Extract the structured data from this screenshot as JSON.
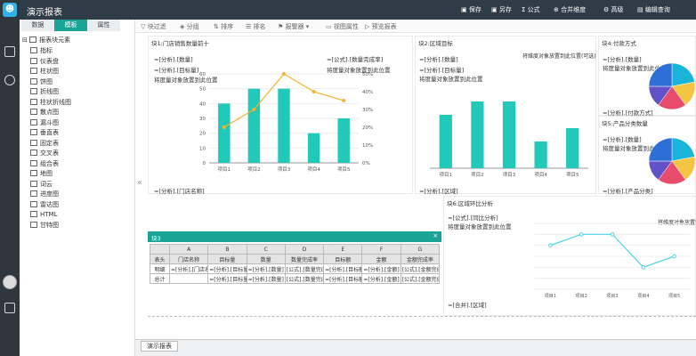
{
  "app": {
    "title": "演示报表"
  },
  "toolbar_top": {
    "save": "保存",
    "saveas": "另存",
    "formula": "公式",
    "merge": "合并维度",
    "advanced": "高级",
    "edit_query": "编辑查询"
  },
  "panel": {
    "tabs": [
      "数据",
      "模板",
      "属性"
    ],
    "root": "报表块元素",
    "items": [
      "指标",
      "仪表盘",
      "柱状图",
      "饼图",
      "折线图",
      "柱状折线图",
      "散点图",
      "漏斗图",
      "垂直表",
      "固定表",
      "交叉表",
      "组合表",
      "地图",
      "词云",
      "进度图",
      "雷达图",
      "HTML",
      "甘特图"
    ]
  },
  "toolbar": {
    "filter": "块过滤",
    "group": "分组",
    "sort": "排序",
    "rank": "排名",
    "alert": "报警器",
    "view_attr": "视图属性",
    "preview": "预览报表"
  },
  "blocks": {
    "b1": {
      "title": "块1:门店销售数量前十",
      "l1": "=[分析].[数量]",
      "l2": "=[公式].[数量完成率]",
      "l3": "=[分析].[目标量]",
      "l4": "将度量对象放置到此位置",
      "l5": "将度量对象放置到此位置",
      "bottom": "=[分析].[门店名称]"
    },
    "b2": {
      "title": "块2:区域目标",
      "l1": "=[分析].[数量]",
      "l2": "将维度对象放置到此位置(可选)",
      "l3": "=[分析].[目标量]",
      "l4": "将度量对象放置到此位置",
      "bottom": "=[分析].[区域]"
    },
    "b4": {
      "title": "块4:付款方式",
      "l1": "=[分析].[数量]",
      "l2": "将度量对象放置到此位置",
      "bottom": "=[分析].[付款方式]"
    },
    "b5": {
      "title": "块5:产品分类数量",
      "l1": "=[分析].[数量]",
      "l2": "将度量对象放置到此位置",
      "bottom": "=[分析].[产品分类]"
    },
    "b3": {
      "title": "块3"
    },
    "b6": {
      "title": "块6:区域环比分析",
      "l1": "=[公式].[同比分析]",
      "l2": "将维度对象放置到此位置",
      "l3": "将度量对象放置到此位置",
      "bottom": "=[合并].[区域]"
    }
  },
  "table": {
    "cols": [
      "A",
      "B",
      "C",
      "D",
      "E",
      "F",
      "G"
    ],
    "header": [
      "表头",
      "门店名称",
      "目标量",
      "数量",
      "数量完成率",
      "目标额",
      "金额",
      "金额完成率"
    ],
    "detail": [
      "明细",
      "=[分析].[门店名称]",
      "=[分析].[目标量]",
      "=[分析].[数量]",
      "[公式].[数量完成率]",
      "=[分析].[目标额]",
      "=[分析].[金额]",
      "[公式].[金额完成率]"
    ],
    "total": [
      "总计",
      "",
      "=[分析].[目标量]",
      "=[分析].[数量]",
      "[公式].[数量完成率]",
      "=[分析].[目标额]",
      "=[分析].[金额]",
      "[公式].[金额完成率]"
    ]
  },
  "sheet_tab": "演示报表",
  "chart_data": [
    {
      "type": "bar",
      "categories": [
        "项目1",
        "项目2",
        "项目3",
        "项目4",
        "项目5"
      ],
      "series": [
        {
          "values": [
            40,
            50,
            50,
            20,
            30
          ]
        }
      ],
      "line": [
        20,
        30,
        50,
        40,
        35
      ],
      "ylim": [
        0,
        60
      ],
      "y2lim": [
        0,
        50
      ],
      "yticks": [
        "0",
        "10",
        "20",
        "30",
        "40",
        "50",
        "60"
      ],
      "y2ticks": [
        "0%",
        "10%",
        "20%",
        "30%",
        "40%",
        "50%"
      ],
      "color": "#22c8b8",
      "line_color": "#f5b32e"
    },
    {
      "type": "bar",
      "categories": [
        "项目1",
        "项目2",
        "项目3",
        "项目4",
        "项目5"
      ],
      "series": [
        {
          "values": [
            40,
            50,
            50,
            20,
            30
          ]
        }
      ],
      "ylim": [
        0,
        60
      ],
      "color": "#22c8b8"
    },
    {
      "type": "pie",
      "slices": [
        22,
        18,
        20,
        15,
        25
      ],
      "colors": [
        "#1ab4d8",
        "#f4c542",
        "#e84b6c",
        "#6252c8",
        "#2d6fd6"
      ]
    },
    {
      "type": "pie",
      "slices": [
        22,
        18,
        20,
        15,
        25
      ],
      "colors": [
        "#1ab4d8",
        "#f4c542",
        "#e84b6c",
        "#6252c8",
        "#2d6fd6"
      ]
    },
    {
      "type": "line",
      "categories": [
        "项目1",
        "项目2",
        "项目3",
        "项目4",
        "项目5"
      ],
      "series": [
        {
          "values": [
            40,
            50,
            50,
            20,
            30
          ]
        }
      ],
      "ylim": [
        0,
        60
      ],
      "color": "#4ed4e6"
    }
  ]
}
